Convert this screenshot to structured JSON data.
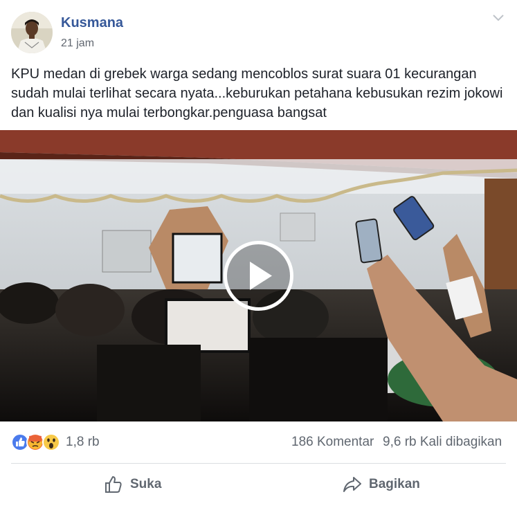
{
  "post": {
    "author": "Kusmana",
    "time": "21 jam",
    "text": "KPU medan di grebek warga sedang mencoblos surat suara 01 kecurangan sudah mulai terlihat secara nyata...keburukan petahana kebusukan rezim jokowi dan kualisi nya mulai terbongkar.penguasa bangsat"
  },
  "media": {
    "type": "video",
    "play_icon": "play-icon"
  },
  "stats": {
    "reaction_icons": [
      "like-icon",
      "angry-icon",
      "wow-icon"
    ],
    "reaction_count": "1,8 rb",
    "comments": "186 Komentar",
    "shares": "9,6 rb Kali dibagikan"
  },
  "actions": {
    "like_label": "Suka",
    "share_label": "Bagikan"
  },
  "colors": {
    "author": "#365899",
    "like_blue": "#3b5998",
    "secondary_text": "#606770"
  }
}
